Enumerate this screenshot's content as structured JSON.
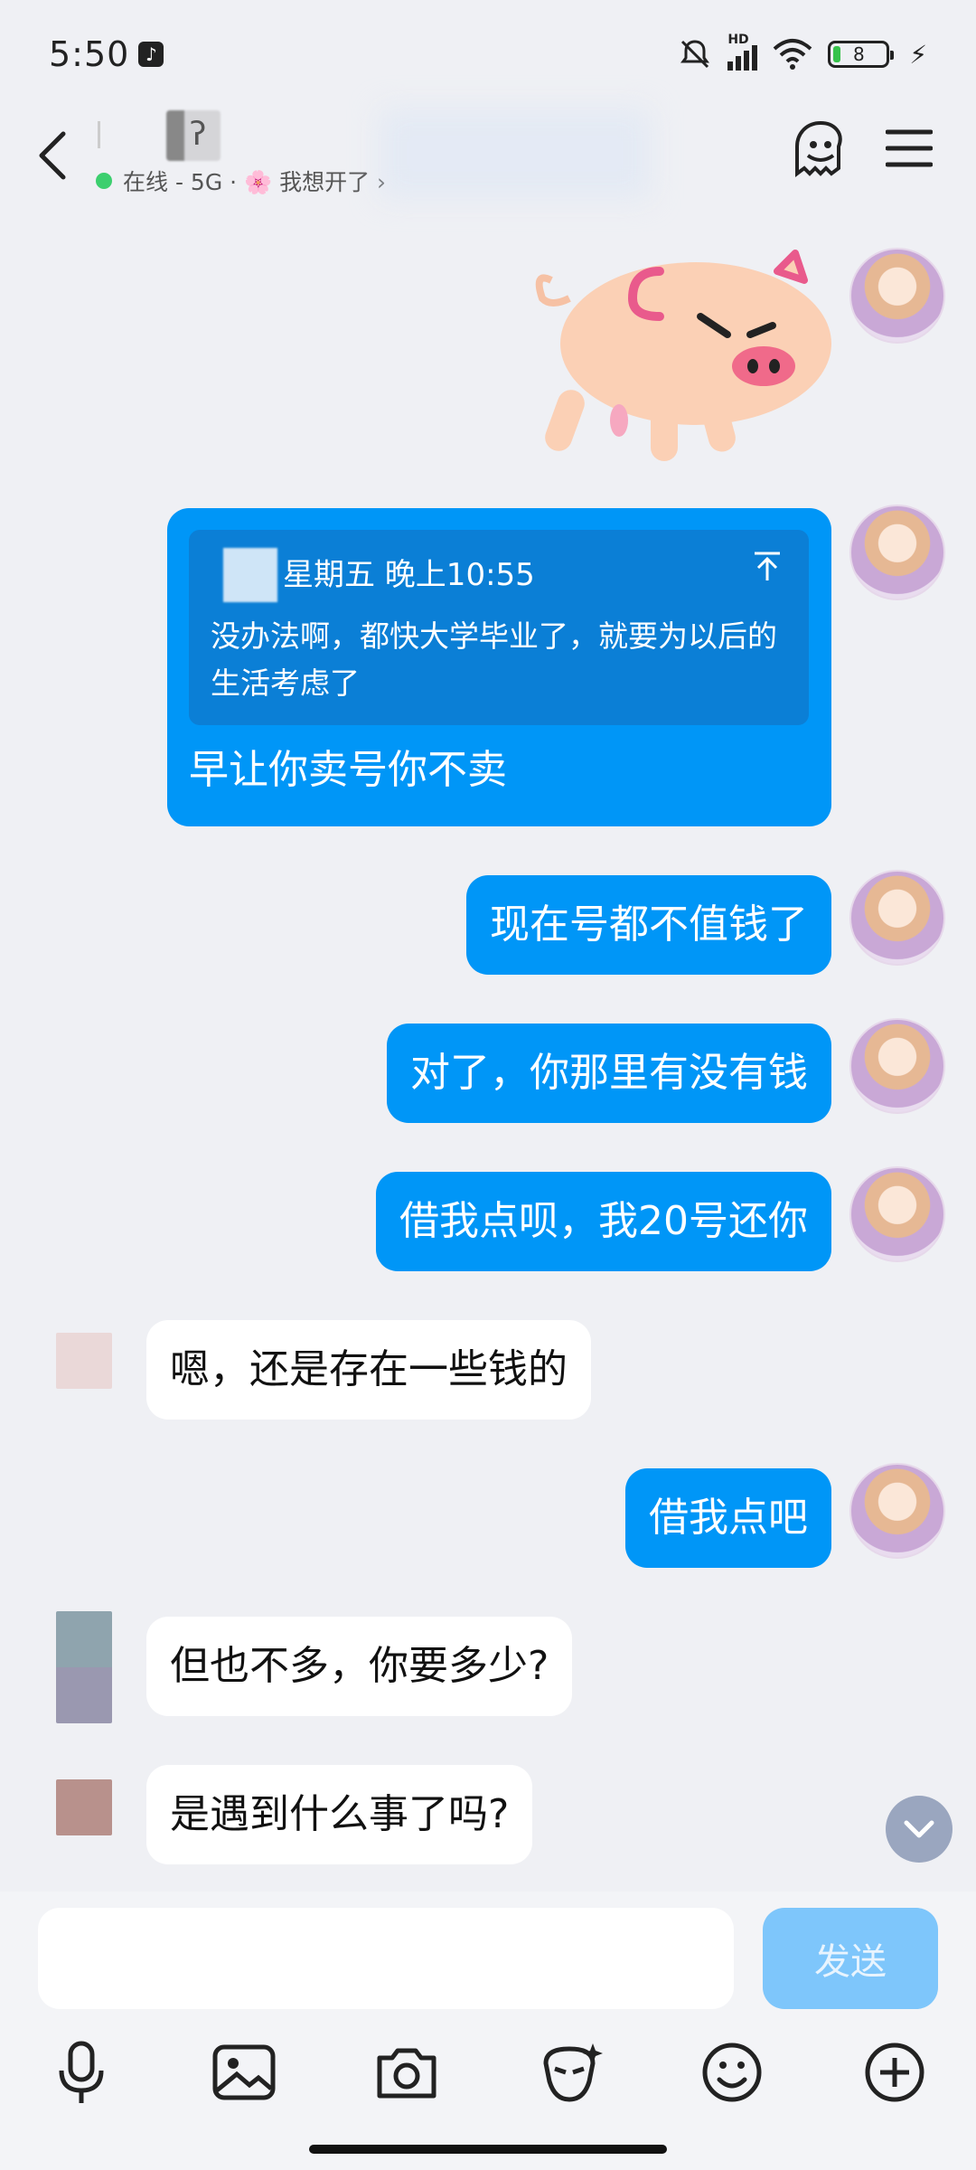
{
  "status_bar": {
    "time": "5:50",
    "network_label": "HD",
    "battery": "8"
  },
  "header": {
    "sub_status": "在线 - 5G · 🌸 我想开了 ›"
  },
  "quote": {
    "meta": "星期五 晚上10:55",
    "text": "没办法啊，都快大学毕业了，就要为以后的生活考虑了",
    "reply": "早让你卖号你不卖"
  },
  "messages": [
    {
      "side": "right",
      "text": "现在号都不值钱了"
    },
    {
      "side": "right",
      "text": "对了，你那里有没有钱"
    },
    {
      "side": "right",
      "text": "借我点呗，我20号还你"
    },
    {
      "side": "left",
      "text": "嗯，还是存在一些钱的"
    },
    {
      "side": "right",
      "text": "借我点吧"
    },
    {
      "side": "left",
      "text": "但也不多，你要多少?"
    },
    {
      "side": "left",
      "text": "是遇到什么事了吗?"
    }
  ],
  "input": {
    "value": "",
    "send_label": "发送"
  },
  "toolbar": {
    "icons": [
      "microphone-icon",
      "image-icon",
      "camera-icon",
      "sticker-icon",
      "emoji-icon",
      "plus-icon"
    ]
  },
  "colors": {
    "bubble_self": "#0096f7",
    "bubble_other": "#ffffff",
    "background": "#eff0f4",
    "send_disabled": "#7ec6fb"
  }
}
